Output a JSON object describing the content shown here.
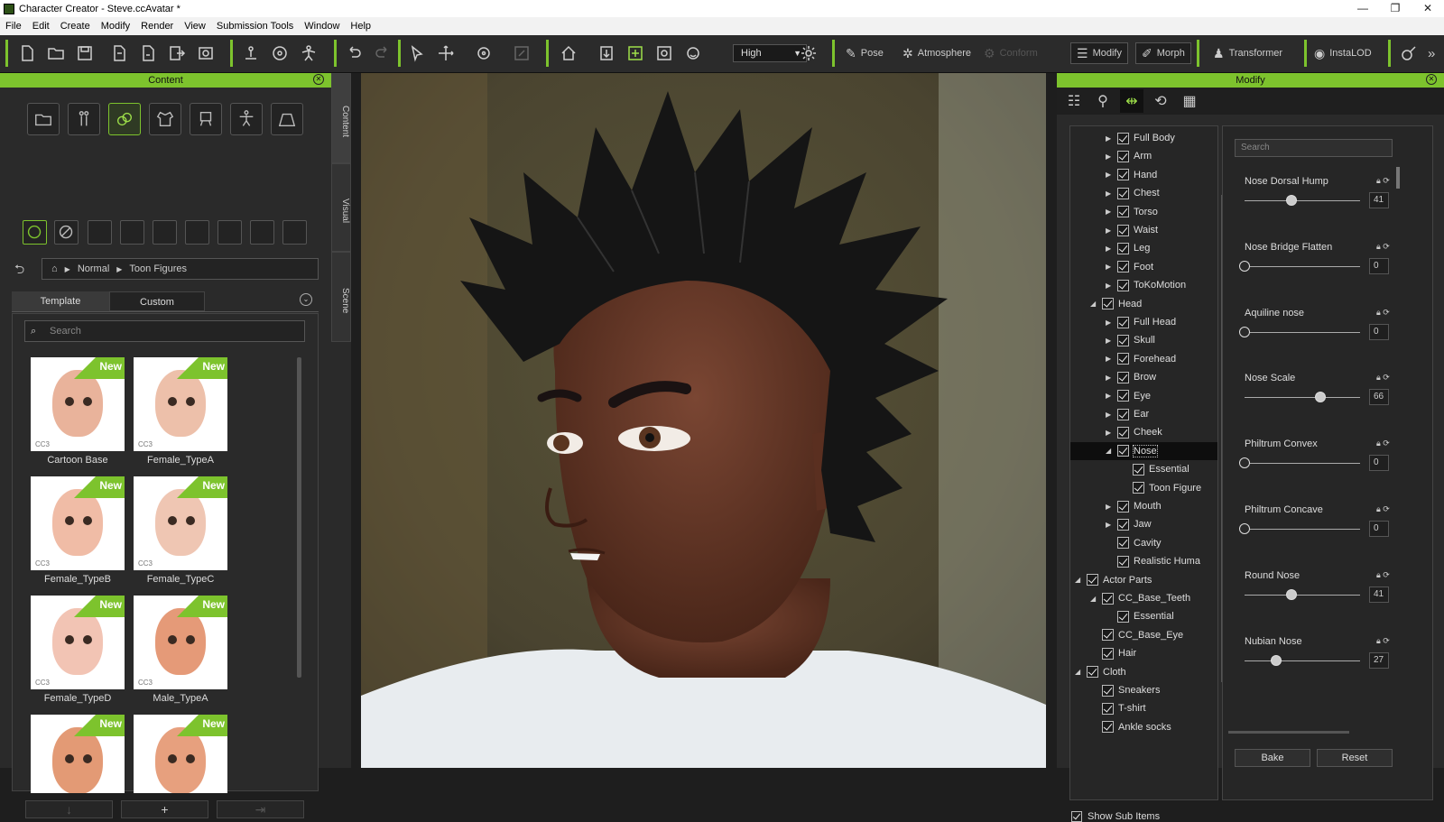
{
  "window": {
    "title": "Character Creator - Steve.ccAvatar *",
    "controls": [
      "—",
      "❐",
      "✕"
    ]
  },
  "menu": [
    "File",
    "Edit",
    "Create",
    "Modify",
    "Render",
    "View",
    "Submission Tools",
    "Window",
    "Help"
  ],
  "toolbar": {
    "quality": "High",
    "pose": "Pose",
    "atmosphere": "Atmosphere",
    "conform": "Conform",
    "modify": "Modify",
    "morph": "Morph",
    "transformer": "Transformer",
    "instalod": "InstaLOD",
    "more": "»"
  },
  "content_panel": {
    "title": "Content",
    "breadcrumb": [
      "Normal",
      "Toon Figures"
    ],
    "tabs": [
      "Template",
      "Custom"
    ],
    "search_placeholder": "Search",
    "new_badge": "New",
    "cc3_tag": "CC3",
    "items": [
      {
        "label": "Cartoon Base"
      },
      {
        "label": "Female_TypeA"
      },
      {
        "label": "Female_TypeB"
      },
      {
        "label": "Female_TypeC"
      },
      {
        "label": "Female_TypeD"
      },
      {
        "label": "Male_TypeA"
      },
      {
        "label": ""
      },
      {
        "label": ""
      }
    ],
    "bottom_buttons": [
      "↓",
      "+",
      "⇥"
    ]
  },
  "side_tabs": [
    "Content",
    "Visual",
    "Scene"
  ],
  "modify_panel": {
    "title": "Modify",
    "search_placeholder": "Search",
    "tree": [
      {
        "label": "Full Body",
        "indent": 3,
        "arrow": "right"
      },
      {
        "label": "Arm",
        "indent": 3,
        "arrow": "right"
      },
      {
        "label": "Hand",
        "indent": 3,
        "arrow": "right"
      },
      {
        "label": "Chest",
        "indent": 3,
        "arrow": "right"
      },
      {
        "label": "Torso",
        "indent": 3,
        "arrow": "right"
      },
      {
        "label": "Waist",
        "indent": 3,
        "arrow": "right"
      },
      {
        "label": "Leg",
        "indent": 3,
        "arrow": "right"
      },
      {
        "label": "Foot",
        "indent": 3,
        "arrow": "right"
      },
      {
        "label": "ToKoMotion",
        "indent": 3,
        "arrow": "right"
      },
      {
        "label": "Head",
        "indent": 2,
        "arrow": "down"
      },
      {
        "label": "Full Head",
        "indent": 3,
        "arrow": "right"
      },
      {
        "label": "Skull",
        "indent": 3,
        "arrow": "right"
      },
      {
        "label": "Forehead",
        "indent": 3,
        "arrow": "right"
      },
      {
        "label": "Brow",
        "indent": 3,
        "arrow": "right"
      },
      {
        "label": "Eye",
        "indent": 3,
        "arrow": "right"
      },
      {
        "label": "Ear",
        "indent": 3,
        "arrow": "right"
      },
      {
        "label": "Cheek",
        "indent": 3,
        "arrow": "right"
      },
      {
        "label": "Nose",
        "indent": 3,
        "arrow": "down",
        "selected": true
      },
      {
        "label": "Essential",
        "indent": 4,
        "arrow": ""
      },
      {
        "label": "Toon Figure",
        "indent": 4,
        "arrow": ""
      },
      {
        "label": "Mouth",
        "indent": 3,
        "arrow": "right"
      },
      {
        "label": "Jaw",
        "indent": 3,
        "arrow": "right"
      },
      {
        "label": "Cavity",
        "indent": 3,
        "arrow": ""
      },
      {
        "label": "Realistic Huma",
        "indent": 3,
        "arrow": ""
      },
      {
        "label": "Actor Parts",
        "indent": 1,
        "arrow": "down"
      },
      {
        "label": "CC_Base_Teeth",
        "indent": 2,
        "arrow": "down"
      },
      {
        "label": "Essential",
        "indent": 3,
        "arrow": ""
      },
      {
        "label": "CC_Base_Eye",
        "indent": 2,
        "arrow": ""
      },
      {
        "label": "Hair",
        "indent": 2,
        "arrow": ""
      },
      {
        "label": "Cloth",
        "indent": 1,
        "arrow": "down"
      },
      {
        "label": "Sneakers",
        "indent": 2,
        "arrow": ""
      },
      {
        "label": "T-shirt",
        "indent": 2,
        "arrow": ""
      },
      {
        "label": "Ankle socks",
        "indent": 2,
        "arrow": ""
      }
    ],
    "show_sub_items": "Show Sub Items",
    "sliders": [
      {
        "name": "Nose Dorsal Hump",
        "value": 41
      },
      {
        "name": "Nose Bridge Flatten",
        "value": 0
      },
      {
        "name": "Aquiline nose",
        "value": 0
      },
      {
        "name": "Nose Scale",
        "value": 66
      },
      {
        "name": "Philtrum Convex",
        "value": 0
      },
      {
        "name": "Philtrum Concave",
        "value": 0
      },
      {
        "name": "Round Nose",
        "value": 41
      },
      {
        "name": "Nubian Nose",
        "value": 27
      }
    ],
    "bake": "Bake",
    "reset": "Reset"
  },
  "colors": {
    "accent": "#7dc32d",
    "panel": "#2a2a2a",
    "skin": "#6b3d2c",
    "hair": "#1a1a1a"
  }
}
